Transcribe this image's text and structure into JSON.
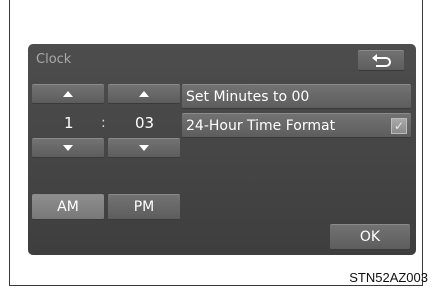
{
  "screen": {
    "title": "Clock",
    "back_icon": "back-return-icon",
    "hour": "1",
    "separator": ":",
    "minute": "03",
    "am_label": "AM",
    "pm_label": "PM",
    "option_set_minutes": "Set Minutes to 00",
    "option_24h": "24-Hour Time Format",
    "ok_label": "OK",
    "selected_period": "AM",
    "checkbox_24h_checked": true
  },
  "figure_ref": "STN52AZ003"
}
